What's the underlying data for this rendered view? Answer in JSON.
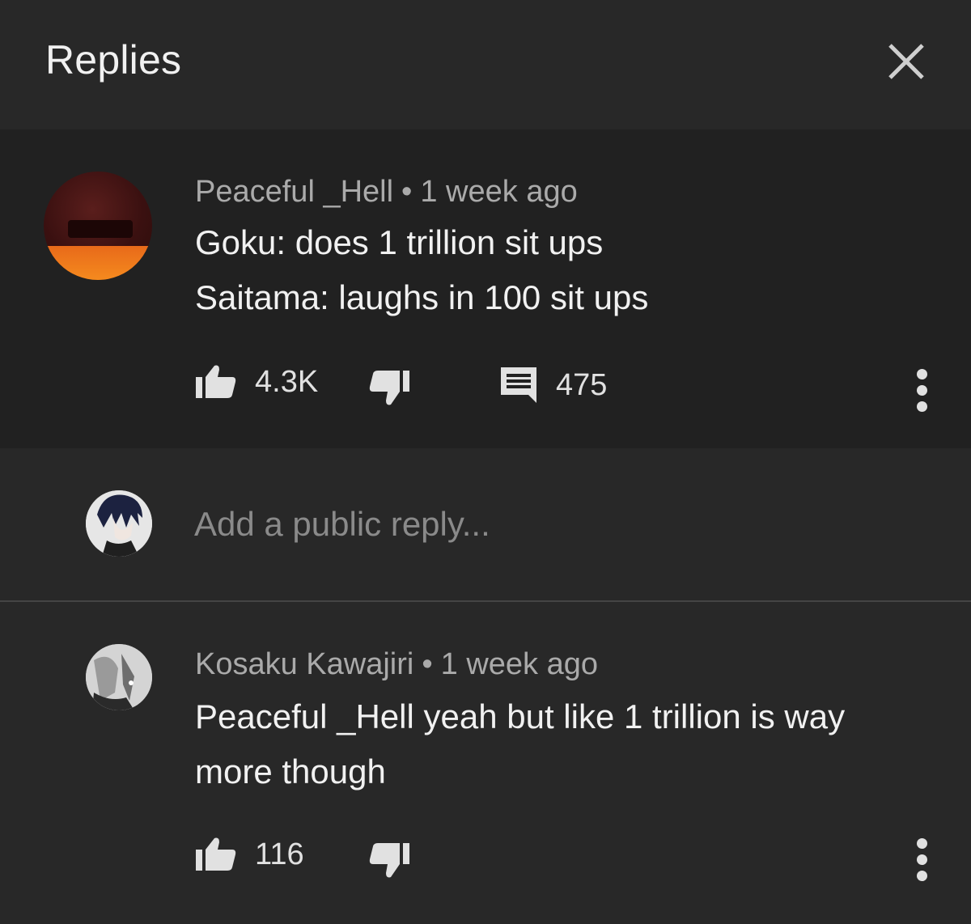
{
  "header": {
    "title": "Replies",
    "close_icon": "close-icon"
  },
  "parent_comment": {
    "author": "Peaceful _Hell",
    "separator": "•",
    "time": "1 week ago",
    "lines": [
      "Goku: does 1 trillion sit ups",
      "Saitama: laughs in 100 sit ups"
    ],
    "likes": "4.3K",
    "replies": "475",
    "icons": [
      "thumbs-up-icon",
      "thumbs-down-icon",
      "comment-icon",
      "more-vert-icon"
    ]
  },
  "reply_box": {
    "placeholder": "Add a public reply..."
  },
  "reply_comment": {
    "author": "Kosaku Kawajiri",
    "separator": "•",
    "time": "1 week ago",
    "lines": [
      "Peaceful _Hell yeah but like 1 trillion is way",
      "more though"
    ],
    "likes": "116",
    "icons": [
      "thumbs-up-icon",
      "thumbs-down-icon",
      "more-vert-icon"
    ]
  },
  "colors": {
    "background": "#282828",
    "highlight_background": "#212121",
    "primary_text": "#f1f1f1",
    "secondary_text": "#aaaaaa",
    "placeholder_text": "#8a8a8a"
  }
}
